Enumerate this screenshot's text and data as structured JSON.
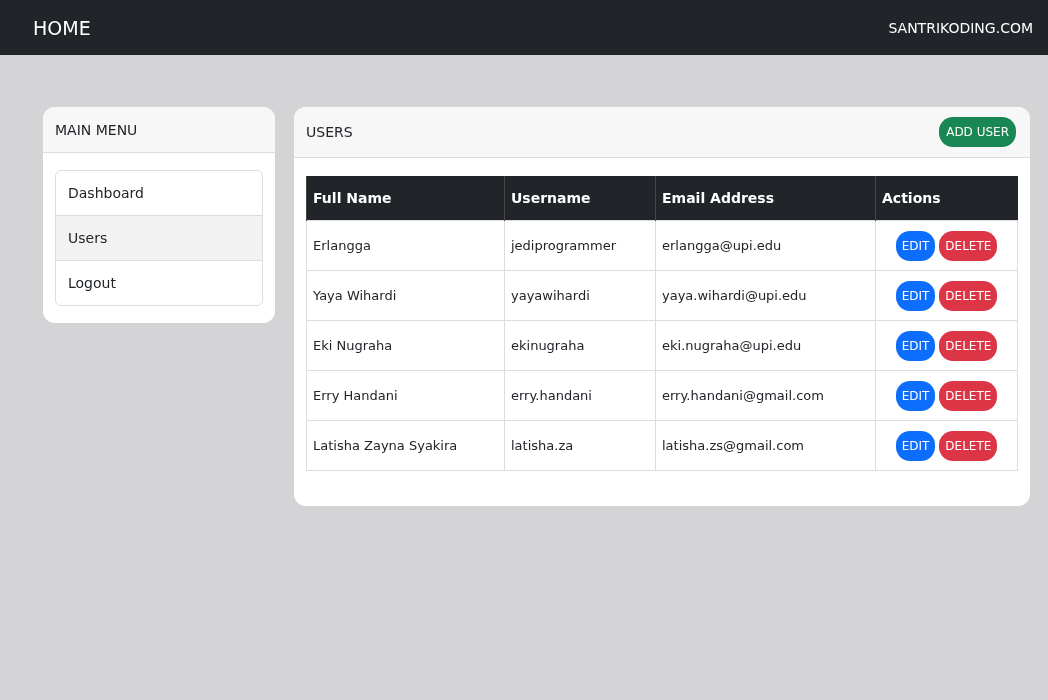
{
  "navbar": {
    "brand": "HOME",
    "site": "SANTRIKODING.COM"
  },
  "sidebar": {
    "title": "MAIN MENU",
    "items": [
      {
        "label": "Dashboard",
        "selected": false
      },
      {
        "label": "Users",
        "selected": true
      },
      {
        "label": "Logout",
        "selected": false
      }
    ]
  },
  "panel": {
    "title": "USERS",
    "add_button": "ADD USER"
  },
  "table": {
    "columns": [
      "Full Name",
      "Username",
      "Email Address",
      "Actions"
    ],
    "rows": [
      {
        "full_name": "Erlangga",
        "username": "jediprogrammer",
        "email": "erlangga@upi.edu",
        "edit": "EDIT",
        "delete": "DELETE"
      },
      {
        "full_name": "Yaya Wihardi",
        "username": "yayawihardi",
        "email": "yaya.wihardi@upi.edu",
        "edit": "EDIT",
        "delete": "DELETE"
      },
      {
        "full_name": "Eki Nugraha",
        "username": "ekinugraha",
        "email": "eki.nugraha@upi.edu",
        "edit": "EDIT",
        "delete": "DELETE"
      },
      {
        "full_name": "Erry Handani",
        "username": "erry.handani",
        "email": "erry.handani@gmail.com",
        "edit": "EDIT",
        "delete": "DELETE"
      },
      {
        "full_name": "Latisha Zayna Syakira",
        "username": "latisha.za",
        "email": "latisha.zs@gmail.com",
        "edit": "EDIT",
        "delete": "DELETE"
      }
    ]
  }
}
